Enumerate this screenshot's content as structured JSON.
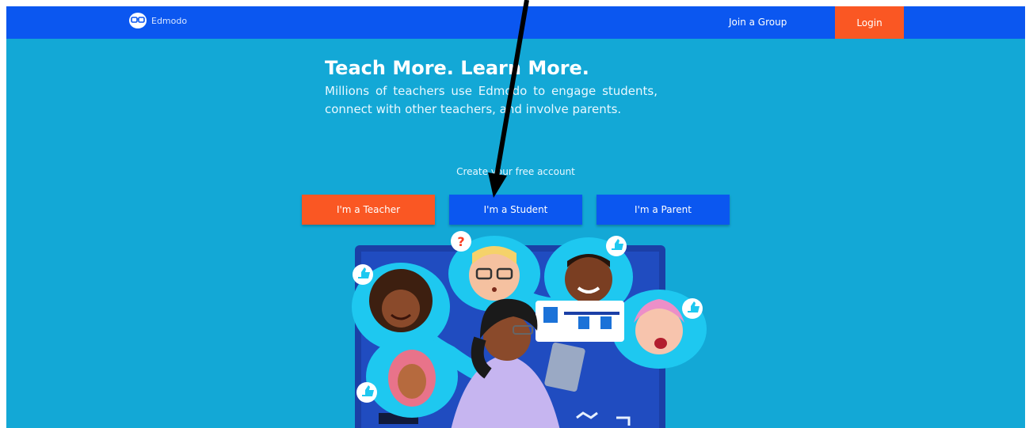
{
  "header": {
    "brand": "Edmodo",
    "join_group": "Join a Group",
    "login": "Login"
  },
  "hero": {
    "title": "Teach More. Learn More.",
    "subtitle": "Millions of teachers use Edmodo to engage students, connect with other teachers, and involve parents.",
    "cta_label": "Create your free account"
  },
  "buttons": {
    "teacher": "I'm a Teacher",
    "student": "I'm a Student",
    "parent": "I'm a Parent"
  },
  "colors": {
    "header": "#0b57f0",
    "background": "#13a8d6",
    "accent": "#fa5723",
    "primary_button": "#0b57f0"
  },
  "icons": [
    "edmodo-logo-icon",
    "thumbs-up-icon",
    "question-mark-icon",
    "annotation-arrow-icon"
  ]
}
